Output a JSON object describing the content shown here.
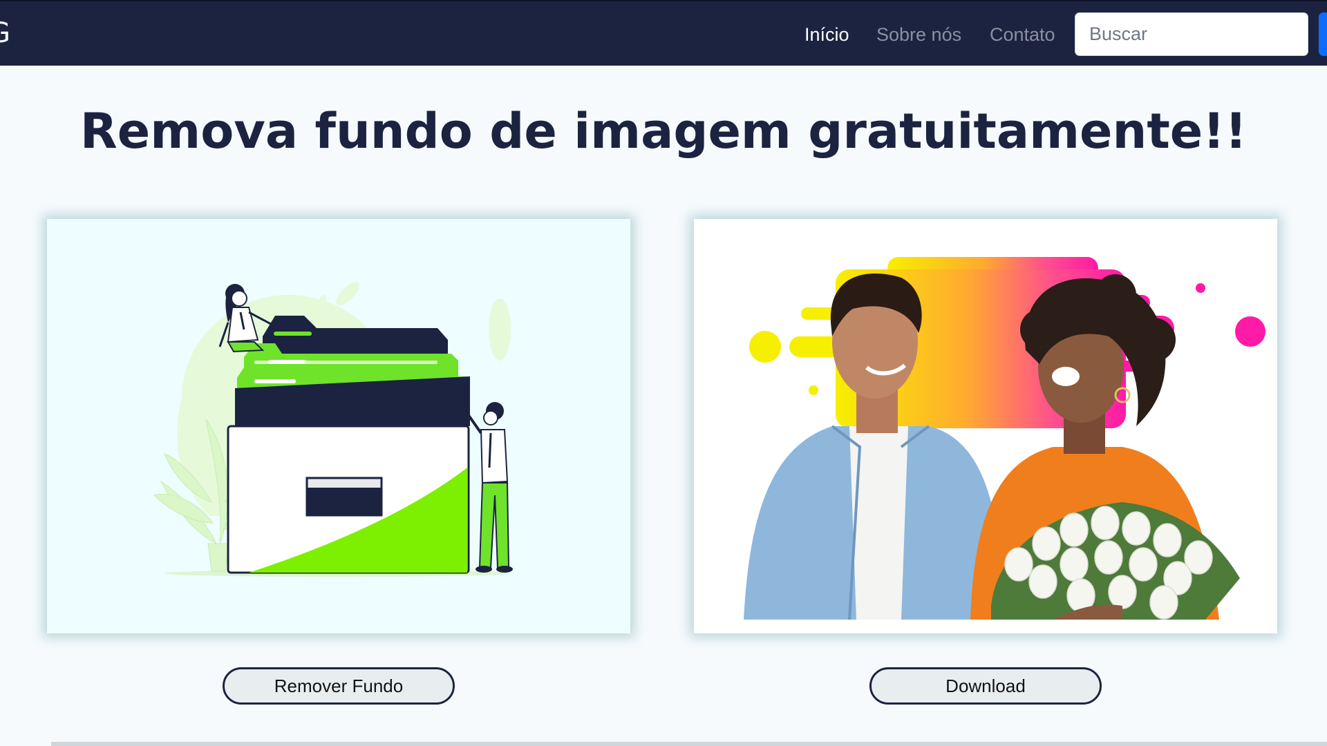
{
  "navbar": {
    "brand": "G",
    "links": [
      {
        "label": "Início",
        "active": true
      },
      {
        "label": "Sobre nós",
        "active": false
      },
      {
        "label": "Contato",
        "active": false
      }
    ],
    "search": {
      "placeholder": "Buscar",
      "value": ""
    }
  },
  "main": {
    "title": "Remova fundo de imagem gratuitamente!!",
    "left_panel": {
      "icon": "file-cabinet-illustration",
      "button_label": "Remover Fundo"
    },
    "right_panel": {
      "icon": "couple-photo",
      "button_label": "Download"
    }
  },
  "colors": {
    "navbar": "#1c2340",
    "title": "#1c2340",
    "accent_green": "#7cf000",
    "button_bg": "#e8eef0",
    "search_button": "#0d6efd"
  }
}
